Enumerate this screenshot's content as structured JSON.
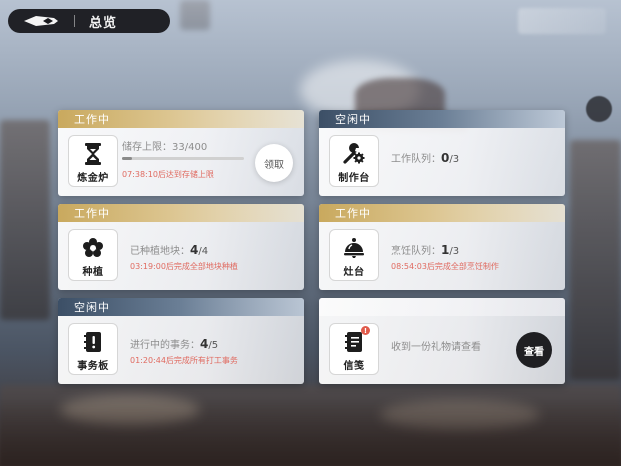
{
  "header": {
    "title": "总览"
  },
  "cards": {
    "alchemy": {
      "status": "工作中",
      "name": "炼金炉",
      "storage_label": "储存上限：",
      "storage_value": "33/400",
      "progress": 0.08,
      "note": "07:38:10后达到存储上限",
      "collect_label": "领取"
    },
    "workbench": {
      "status": "空闲中",
      "name": "制作台",
      "queue_label": "工作队列：",
      "queue_current": "0",
      "queue_total": "/3"
    },
    "planting": {
      "status": "工作中",
      "name": "种植",
      "plots_label": "已种植地块：",
      "plots_current": "4",
      "plots_total": "/4",
      "note": "03:19:00后完成全部地块种植"
    },
    "stove": {
      "status": "工作中",
      "name": "灶台",
      "queue_label": "烹饪队列：",
      "queue_current": "1",
      "queue_total": "/3",
      "note": "08:54:03后完成全部烹饪制作"
    },
    "tasks": {
      "status": "空闲中",
      "name": "事务板",
      "tasks_label": "进行中的事务：",
      "tasks_current": "4",
      "tasks_total": "/5",
      "note": "01:20:44后完成所有打工事务"
    },
    "mail": {
      "status": "空闲中",
      "name": "信笺",
      "message": "收到一份礼物请查看",
      "badge": "!",
      "view_label": "查看"
    }
  },
  "colors": {
    "working_header": "#c9a95e",
    "idle_header": "#3c4f66",
    "note_red": "#e06b61",
    "view_button": "#1f1f22"
  },
  "icons": {
    "back": "back-arrow-icon",
    "alchemy": "hourglass-icon",
    "workbench": "wrench-gear-icon",
    "planting": "flower-icon",
    "stove": "cloche-icon",
    "tasks": "notebook-exclamation-icon",
    "mail": "notebook-icon"
  }
}
